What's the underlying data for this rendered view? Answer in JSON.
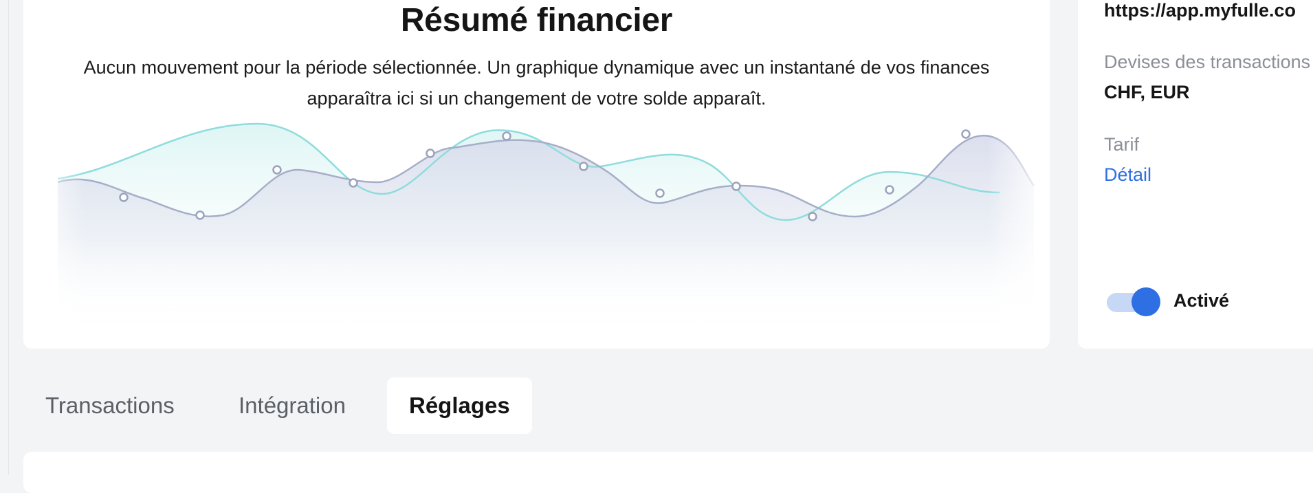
{
  "summary": {
    "title": "Résumé financier",
    "description": "Aucun mouvement pour la période sélectionnée. Un graphique dynamique avec un instantané de vos finances apparaîtra ici si un changement de votre solde apparaît."
  },
  "side_panel": {
    "url": "https://app.myfulle.co",
    "currencies_label": "Devises des transactions",
    "currencies_value": "CHF, EUR",
    "rate_label": "Tarif",
    "rate_link": "Détail",
    "toggle_on": true,
    "toggle_label": "Activé"
  },
  "tabs": [
    {
      "label": "Transactions",
      "active": false
    },
    {
      "label": "Intégration",
      "active": false
    },
    {
      "label": "Réglages",
      "active": true
    }
  ],
  "colors": {
    "accent": "#2f6fe4",
    "placeholder_line_primary": "#a6aec8",
    "placeholder_line_secondary": "#8fdcdc"
  }
}
